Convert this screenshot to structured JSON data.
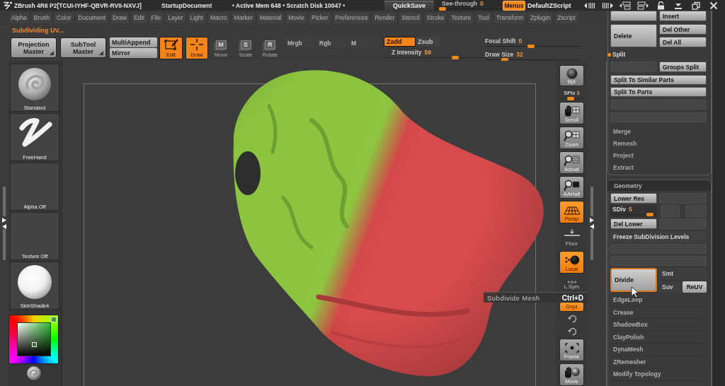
{
  "title_bar": {
    "app_title": "ZBrush 4R6 P2[TCUI-IYHF-QBVR-RVII-NXVJ]",
    "document": "StartupDocument",
    "status": "• Active Mem 648 • Scratch Disk 10047 •",
    "quicksave": "QuickSave",
    "see_through": {
      "label": "See-through",
      "value": "0",
      "level": 0
    },
    "menus": {
      "label": "Menus",
      "on": true
    },
    "zscript": "DefaultZScript"
  },
  "menu_bar": [
    "Alpha",
    "Brush",
    "Color",
    "Document",
    "Draw",
    "Edit",
    "File",
    "Layer",
    "Light",
    "Macro",
    "Marker",
    "Material",
    "Movie",
    "Picker",
    "Preferences",
    "Render",
    "Stencil",
    "Stroke",
    "Texture",
    "Tool",
    "Transform",
    "Zplugin",
    "Zscript"
  ],
  "status_line": "Subdividing UV...",
  "toolbar": {
    "masters": [
      "Projection Master",
      "SubTool Master"
    ],
    "append": [
      "MultiAppend",
      "Mirror"
    ],
    "modes": [
      {
        "kind": "edit",
        "label": "Edit",
        "selected": true
      },
      {
        "kind": "draw",
        "label": "Draw",
        "selected": true
      },
      {
        "kind": "move",
        "key": "M",
        "label": "Move",
        "selected": false
      },
      {
        "kind": "scale",
        "key": "S",
        "label": "Scale",
        "selected": false
      },
      {
        "kind": "rotate",
        "key": "R",
        "label": "Rotate",
        "selected": false
      }
    ],
    "color_modes": [
      {
        "label": "Mrgb",
        "selected": false
      },
      {
        "label": "Rgb",
        "selected": false
      },
      {
        "label": "M",
        "selected": false
      }
    ],
    "z_modes": [
      {
        "label": "Zadd",
        "selected": true
      },
      {
        "label": "Zsub",
        "selected": false
      }
    ],
    "sliders": [
      {
        "label": "Z Intensity",
        "value": "59",
        "level": 0.74
      },
      {
        "label": "Focal Shift",
        "value": "0",
        "level": 0.48
      },
      {
        "label": "Draw Size",
        "value": "32",
        "level": 0.18
      }
    ]
  },
  "left_shelf": {
    "items": [
      {
        "kind": "brush",
        "label": "Standard"
      },
      {
        "kind": "stroke",
        "label": "FreeHand"
      },
      {
        "kind": "alpha",
        "label": "Alpha Off"
      },
      {
        "kind": "texture",
        "label": "Texture Off"
      },
      {
        "kind": "material",
        "label": "SkinShade4"
      }
    ]
  },
  "canvas": {
    "tooltip": {
      "text": "Subdivide Mesh",
      "shortcut": "Ctrl+D"
    }
  },
  "right_shelf": {
    "bpr": {
      "label": "Bpr"
    },
    "spix": {
      "label": "SPix",
      "value": "3",
      "level": 0.45
    },
    "tools": [
      {
        "kind": "scroll",
        "label": "Scroll",
        "on": false
      },
      {
        "kind": "zoom",
        "label": "Zoom",
        "on": false
      },
      {
        "kind": "actual",
        "label": "Actual",
        "on": false
      },
      {
        "kind": "aahalf",
        "label": "AAHalf",
        "on": false
      },
      {
        "kind": "persp",
        "label": "Persp",
        "on": true
      },
      {
        "kind": "floor",
        "label": "Floor",
        "on": false
      },
      {
        "kind": "local",
        "label": "Local",
        "on": true
      },
      {
        "kind": "lsym",
        "label": "L.Sym",
        "on": false
      },
      {
        "kind": "gxyz",
        "label": "Gxyz",
        "on": true
      },
      {
        "kind": "rotate",
        "on": false
      },
      {
        "kind": "rotate",
        "on": false
      },
      {
        "kind": "frame",
        "label": "Frame",
        "on": false
      },
      {
        "kind": "move",
        "label": "Move",
        "on": false
      }
    ]
  },
  "subtool_panel": {
    "insert": "Insert",
    "delete": "Delete",
    "del_other": "Del Other",
    "del_all": "Del All",
    "split": {
      "title": "Split",
      "groups_split": "Groups Split",
      "buttons": [
        "Split To Similar Parts",
        "Split To Parts"
      ]
    },
    "subpalettes": [
      "Merge",
      "Remesh",
      "Project",
      "Extract"
    ]
  },
  "geometry_panel": {
    "title": "Geometry",
    "lower_res": "Lower Res",
    "sdiv": {
      "label": "SDiv",
      "value": "5",
      "level": 0.95
    },
    "del_lower": "Del Lower",
    "freeze": "Freeze SubDivision Levels",
    "divide": {
      "label": "Divide",
      "hovered": true
    },
    "smt": "Smt",
    "suv": "Suv",
    "reuv": "ReUV",
    "subpalettes": [
      "EdgeLoop",
      "Crease",
      "ShadowBox",
      "ClayPolish",
      "DynaMesh",
      "ZRemesher",
      "Modify Topology"
    ]
  }
}
